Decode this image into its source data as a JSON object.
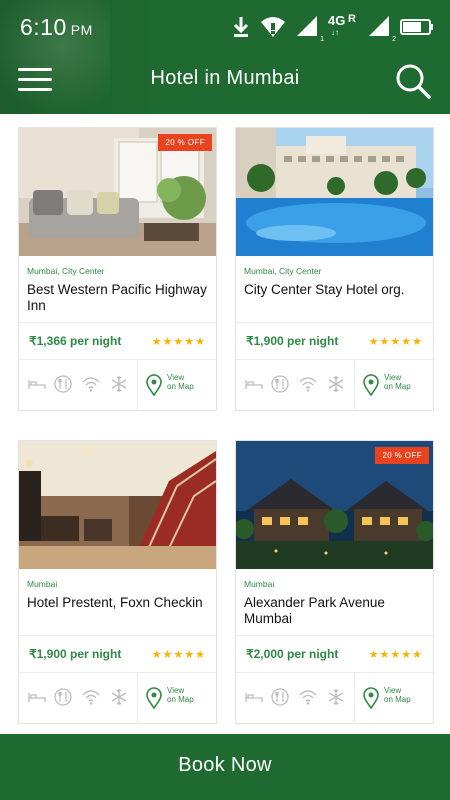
{
  "status": {
    "time": "6:10",
    "ampm": "PM",
    "network": "4G",
    "roaming": "R",
    "sim1": "1",
    "sim2": "2"
  },
  "header": {
    "title": "Hotel in Mumbai"
  },
  "colors": {
    "primary": "#1f6a31",
    "accent": "#2e8a45",
    "badge": "#e8421f",
    "stars": "#f4b400"
  },
  "hotels": [
    {
      "location": "Mumbai, City Center",
      "name": "Best Western Pacific Highway Inn",
      "price": "₹1,366 per night",
      "rating": "★★★★★",
      "discount": "20 % OFF",
      "map_line1": "View",
      "map_line2": "on Map"
    },
    {
      "location": "Mumbai, City Center",
      "name": "City Center Stay Hotel org.",
      "price": "₹1,900 per night",
      "rating": "★★★★★",
      "discount": "",
      "map_line1": "View",
      "map_line2": "on Map"
    },
    {
      "location": "Mumbai",
      "name": "Hotel Prestent, Foxn Checkin",
      "price": "₹1,900 per night",
      "rating": "★★★★★",
      "discount": "",
      "map_line1": "View",
      "map_line2": "on Map"
    },
    {
      "location": "Mumbai",
      "name": "Alexander Park Avenue Mumbai",
      "price": "₹2,000 per night",
      "rating": "★★★★★",
      "discount": "20 % OFF",
      "map_line1": "View",
      "map_line2": "on Map"
    }
  ],
  "amenity_icons": [
    "bed-icon",
    "restaurant-icon",
    "wifi-icon",
    "ac-snowflake-icon"
  ],
  "footer": {
    "book_label": "Book Now"
  }
}
